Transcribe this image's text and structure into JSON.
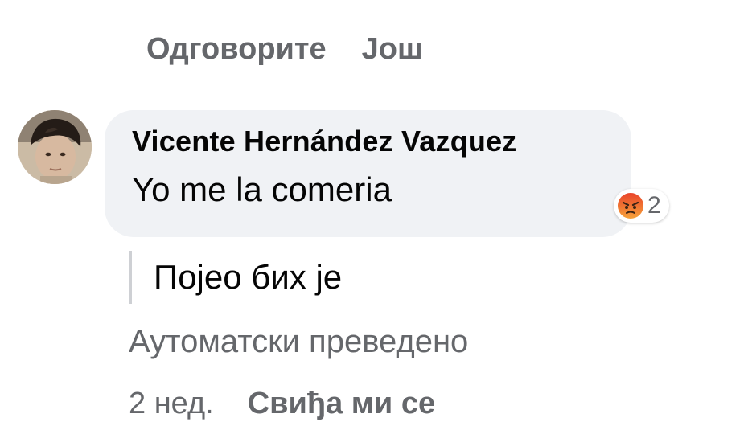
{
  "top_actions": {
    "reply": "Одговорите",
    "more": "Још"
  },
  "comment": {
    "author": "Vicente Hernández Vazquez",
    "text": "Yo me la comeria",
    "reaction_icon": "angry-reaction-icon",
    "reaction_count": "2",
    "translation": "Појео бих је",
    "auto_translated_label": "Аутоматски преведено",
    "time": "2 нед.",
    "like_label": "Свиђа ми се"
  },
  "colors": {
    "bubble_bg": "#f0f2f5",
    "secondary_text": "#65676b",
    "primary_text": "#050505",
    "angry_orange": "#f0683b"
  }
}
